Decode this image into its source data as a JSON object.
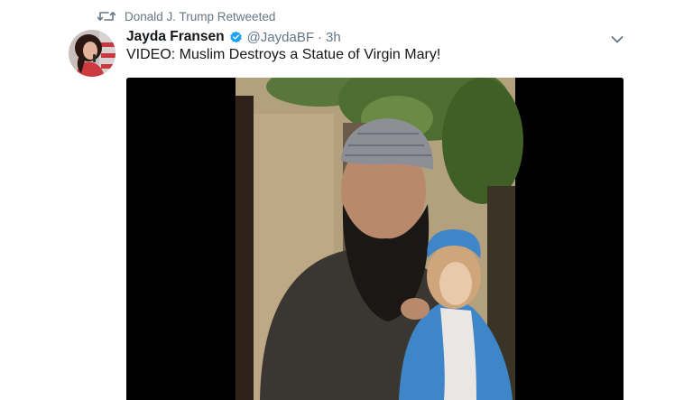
{
  "retweet_context": {
    "icon": "retweet-icon",
    "text": "Donald J. Trump Retweeted"
  },
  "author": {
    "display_name": "Jayda Fransen",
    "verified": true,
    "verified_icon": "verified-badge-icon",
    "screen_name": "@JaydaBF",
    "separator": "·",
    "timestamp": "3h"
  },
  "menu": {
    "icon": "chevron-down-icon"
  },
  "tweet": {
    "text": "VIDEO: Muslim Destroys a Statue of Virgin Mary!"
  },
  "media": {
    "type": "video"
  },
  "colors": {
    "secondary_text": "#657786",
    "primary_text": "#14171a",
    "verified_blue": "#1da1f2",
    "media_background": "#000000"
  }
}
